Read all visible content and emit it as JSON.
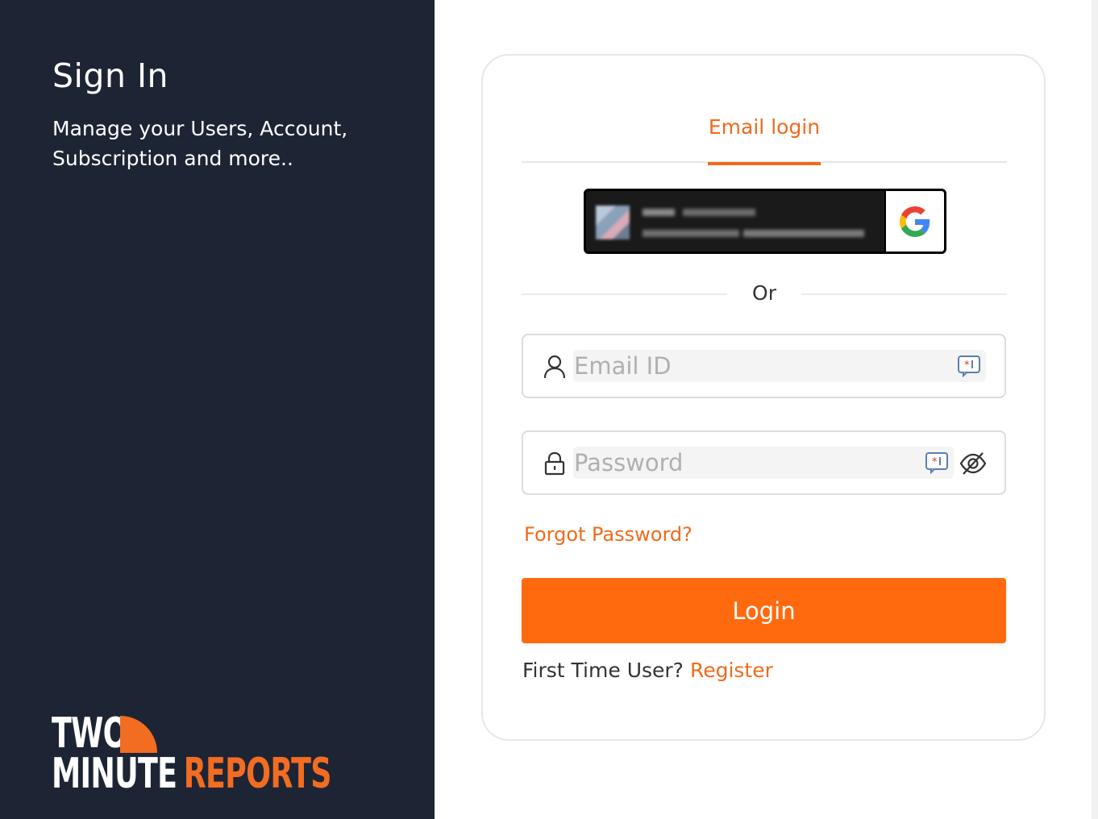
{
  "left_panel": {
    "title": "Sign In",
    "subtitle": "Manage your Users, Account, Subscription and more..",
    "logo": {
      "line1": "TWO",
      "line2_white": "MINUTE",
      "line2_orange": "REPORTS"
    }
  },
  "login_card": {
    "tab_label": "Email login",
    "google_button": {
      "icon": "google-g-icon"
    },
    "divider_text": "Or",
    "email_field": {
      "placeholder": "Email ID",
      "value": "",
      "icon": "user-icon"
    },
    "password_field": {
      "placeholder": "Password",
      "value": "",
      "icon": "lock-icon",
      "toggle_icon": "eye-slash-icon"
    },
    "forgot_password": "Forgot Password?",
    "login_button": "Login",
    "first_time_text": "First Time User?",
    "register_link": "Register"
  },
  "colors": {
    "left_bg": "#1d2535",
    "accent": "#f06a1b",
    "button": "#ff6a0f"
  }
}
